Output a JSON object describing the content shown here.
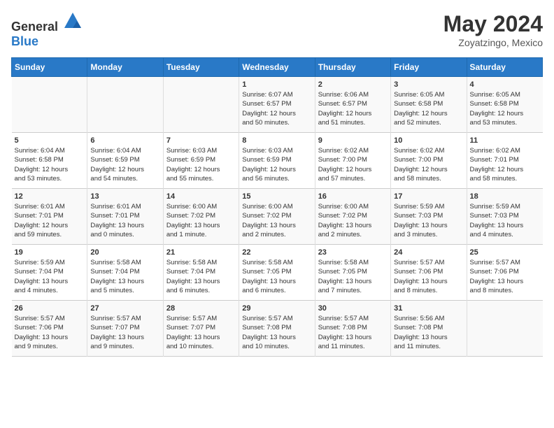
{
  "header": {
    "logo": {
      "general": "General",
      "blue": "Blue"
    },
    "month": "May 2024",
    "location": "Zoyatzingo, Mexico"
  },
  "weekdays": [
    "Sunday",
    "Monday",
    "Tuesday",
    "Wednesday",
    "Thursday",
    "Friday",
    "Saturday"
  ],
  "weeks": [
    [
      {
        "day": "",
        "info": ""
      },
      {
        "day": "",
        "info": ""
      },
      {
        "day": "",
        "info": ""
      },
      {
        "day": "1",
        "info": "Sunrise: 6:07 AM\nSunset: 6:57 PM\nDaylight: 12 hours\nand 50 minutes."
      },
      {
        "day": "2",
        "info": "Sunrise: 6:06 AM\nSunset: 6:57 PM\nDaylight: 12 hours\nand 51 minutes."
      },
      {
        "day": "3",
        "info": "Sunrise: 6:05 AM\nSunset: 6:58 PM\nDaylight: 12 hours\nand 52 minutes."
      },
      {
        "day": "4",
        "info": "Sunrise: 6:05 AM\nSunset: 6:58 PM\nDaylight: 12 hours\nand 53 minutes."
      }
    ],
    [
      {
        "day": "5",
        "info": "Sunrise: 6:04 AM\nSunset: 6:58 PM\nDaylight: 12 hours\nand 53 minutes."
      },
      {
        "day": "6",
        "info": "Sunrise: 6:04 AM\nSunset: 6:59 PM\nDaylight: 12 hours\nand 54 minutes."
      },
      {
        "day": "7",
        "info": "Sunrise: 6:03 AM\nSunset: 6:59 PM\nDaylight: 12 hours\nand 55 minutes."
      },
      {
        "day": "8",
        "info": "Sunrise: 6:03 AM\nSunset: 6:59 PM\nDaylight: 12 hours\nand 56 minutes."
      },
      {
        "day": "9",
        "info": "Sunrise: 6:02 AM\nSunset: 7:00 PM\nDaylight: 12 hours\nand 57 minutes."
      },
      {
        "day": "10",
        "info": "Sunrise: 6:02 AM\nSunset: 7:00 PM\nDaylight: 12 hours\nand 58 minutes."
      },
      {
        "day": "11",
        "info": "Sunrise: 6:02 AM\nSunset: 7:01 PM\nDaylight: 12 hours\nand 58 minutes."
      }
    ],
    [
      {
        "day": "12",
        "info": "Sunrise: 6:01 AM\nSunset: 7:01 PM\nDaylight: 12 hours\nand 59 minutes."
      },
      {
        "day": "13",
        "info": "Sunrise: 6:01 AM\nSunset: 7:01 PM\nDaylight: 13 hours\nand 0 minutes."
      },
      {
        "day": "14",
        "info": "Sunrise: 6:00 AM\nSunset: 7:02 PM\nDaylight: 13 hours\nand 1 minute."
      },
      {
        "day": "15",
        "info": "Sunrise: 6:00 AM\nSunset: 7:02 PM\nDaylight: 13 hours\nand 2 minutes."
      },
      {
        "day": "16",
        "info": "Sunrise: 6:00 AM\nSunset: 7:02 PM\nDaylight: 13 hours\nand 2 minutes."
      },
      {
        "day": "17",
        "info": "Sunrise: 5:59 AM\nSunset: 7:03 PM\nDaylight: 13 hours\nand 3 minutes."
      },
      {
        "day": "18",
        "info": "Sunrise: 5:59 AM\nSunset: 7:03 PM\nDaylight: 13 hours\nand 4 minutes."
      }
    ],
    [
      {
        "day": "19",
        "info": "Sunrise: 5:59 AM\nSunset: 7:04 PM\nDaylight: 13 hours\nand 4 minutes."
      },
      {
        "day": "20",
        "info": "Sunrise: 5:58 AM\nSunset: 7:04 PM\nDaylight: 13 hours\nand 5 minutes."
      },
      {
        "day": "21",
        "info": "Sunrise: 5:58 AM\nSunset: 7:04 PM\nDaylight: 13 hours\nand 6 minutes."
      },
      {
        "day": "22",
        "info": "Sunrise: 5:58 AM\nSunset: 7:05 PM\nDaylight: 13 hours\nand 6 minutes."
      },
      {
        "day": "23",
        "info": "Sunrise: 5:58 AM\nSunset: 7:05 PM\nDaylight: 13 hours\nand 7 minutes."
      },
      {
        "day": "24",
        "info": "Sunrise: 5:57 AM\nSunset: 7:06 PM\nDaylight: 13 hours\nand 8 minutes."
      },
      {
        "day": "25",
        "info": "Sunrise: 5:57 AM\nSunset: 7:06 PM\nDaylight: 13 hours\nand 8 minutes."
      }
    ],
    [
      {
        "day": "26",
        "info": "Sunrise: 5:57 AM\nSunset: 7:06 PM\nDaylight: 13 hours\nand 9 minutes."
      },
      {
        "day": "27",
        "info": "Sunrise: 5:57 AM\nSunset: 7:07 PM\nDaylight: 13 hours\nand 9 minutes."
      },
      {
        "day": "28",
        "info": "Sunrise: 5:57 AM\nSunset: 7:07 PM\nDaylight: 13 hours\nand 10 minutes."
      },
      {
        "day": "29",
        "info": "Sunrise: 5:57 AM\nSunset: 7:08 PM\nDaylight: 13 hours\nand 10 minutes."
      },
      {
        "day": "30",
        "info": "Sunrise: 5:57 AM\nSunset: 7:08 PM\nDaylight: 13 hours\nand 11 minutes."
      },
      {
        "day": "31",
        "info": "Sunrise: 5:56 AM\nSunset: 7:08 PM\nDaylight: 13 hours\nand 11 minutes."
      },
      {
        "day": "",
        "info": ""
      }
    ]
  ]
}
